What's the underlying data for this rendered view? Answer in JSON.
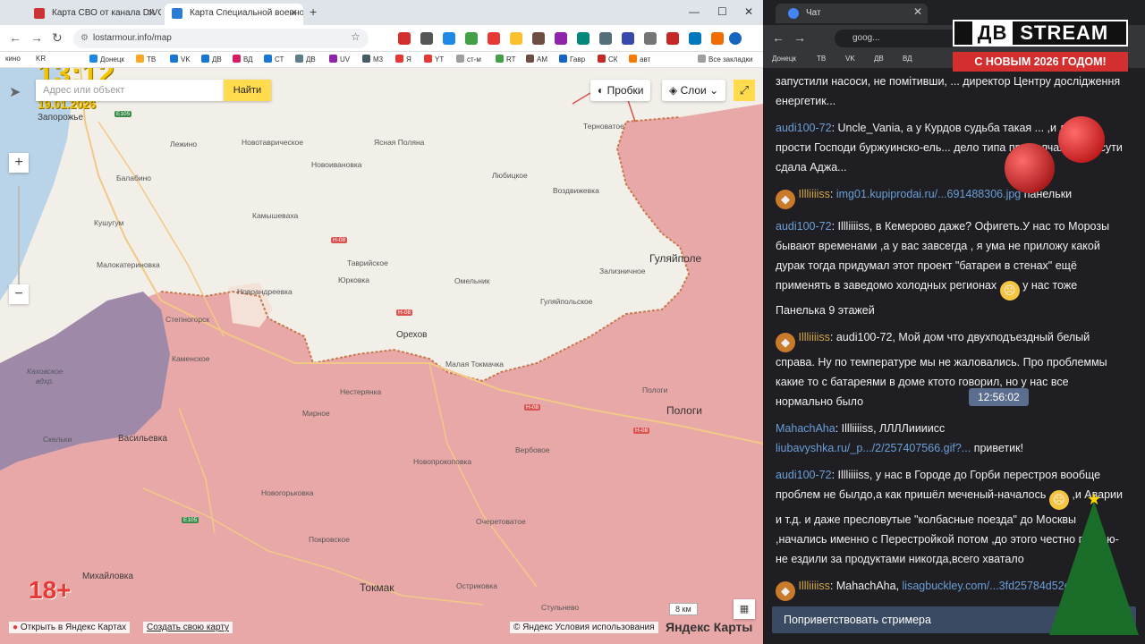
{
  "left_browser": {
    "tabs": [
      {
        "label": "Карта СВО от канала DIVGEN"
      },
      {
        "label": "Карта Специальной военной"
      }
    ],
    "new_tab": "+",
    "address": "lostarmour.info/map",
    "bookmarks": [
      "кино",
      "KR",
      "Донецк",
      "ТВ",
      "VK",
      "ДВ",
      "ВД",
      "СТ",
      "ДВ",
      "UV",
      "М3",
      "Я",
      "YT",
      "ст-м",
      "RT",
      "AM",
      "Гавр",
      "СК",
      "авт",
      "Все закладки"
    ]
  },
  "map": {
    "overlay_time": "13:12",
    "overlay_date": "19.01.2026",
    "search_placeholder": "Адрес или объект",
    "search_button": "Найти",
    "traffic_button": "Пробки",
    "layers_button": "Слои",
    "zoom_in": "+",
    "zoom_out": "−",
    "age_rating": "18+",
    "scale": "8 км",
    "open_in_yandex": "Открыть в Яндекс Картах",
    "create_map": "Создать свою карту",
    "copyright": "© Яндекс Условия использования",
    "yandex_logo": "Яндекс Карты",
    "places": {
      "zaporozhye": "Запорожье",
      "lezhino": "Лежино",
      "novotavricheskoe": "Новотаврическое",
      "yasnaya_polyana": "Ясная Поляна",
      "ternovatoe": "Терноватое",
      "novoivanovka": "Новоивановка",
      "lyubitskoe": "Любицкое",
      "balabino": "Балабино",
      "vozdvizhevka": "Воздвижевка",
      "kushugum": "Кушугум",
      "kamyshevakha": "Камышеваха",
      "malokaterinovka": "Малокатериновка",
      "tavricheskoe": "Таврийское",
      "yurkovka": "Юрковка",
      "omelnik": "Омельник",
      "zalizhnichnoe": "Зализничное",
      "gulyaipole": "Гуляйполе",
      "gulyaipolskoe": "Гуляйпольское",
      "novoandreevka": "Новоандреевка",
      "novoyakovlevka": "Новояковлевка",
      "stepnogorsk": "Степногорск",
      "orekhov": "Орехов",
      "kamenskoe": "Каменское",
      "malaya_tokmachka": "Малая Токмачка",
      "kakhovskoe": "Каховское",
      "vdkhr": "вдхр.",
      "nesteryanka": "Нестерянка",
      "pologi_small": "Пологи",
      "mirnoe": "Мирное",
      "pologi": "Пологи",
      "skelki": "Скельки",
      "vasilievka": "Васильевка",
      "verbovoe": "Вербовое",
      "novoprokopovka": "Новопрокоповка",
      "novogorodka": "Новогорьковка",
      "ocheretovatoe": "Очеретоватое",
      "pokrovskoe": "Покровское",
      "mikhailovka": "Михайловка",
      "tokmak": "Токмак",
      "ostrikovka": "Остриковка",
      "stulnevo": "Стульнево"
    },
    "roads": [
      "E105",
      "H-08",
      "H-08",
      "H-08",
      "H-08",
      "E105"
    ]
  },
  "right_browser": {
    "tab_label": "Чат",
    "address": "goog...",
    "bookmarks": [
      "Донецк",
      "ТВ",
      "VK",
      "ДВ",
      "ВД"
    ]
  },
  "chat": {
    "messages": [
      {
        "user": "",
        "text": "запустили насоси, не помітивши, ... директор Центру дослідження енергетик..."
      },
      {
        "user": "audi100-72",
        "text": "Uncle_Vania, а у Курдов судьба такая ... ,и даже прости Господи буржуинско-ель... дело типа промолчала и по сути сдала Аджа..."
      },
      {
        "user": "Illliiiiss",
        "link": "img01.kupiprodai.ru/...691488306.jpg",
        "text": "панельки"
      },
      {
        "user": "audi100-72",
        "text": "Illliiiiss, в Кемерово даже? Офигеть.У нас то Морозы бывают временами ,а у вас завсегда , я ума не приложу какой дурак тогда придумал этот проект \"батареи в стенах\" ещё применять в заведомо холодных регионах",
        "tail": "у нас тоже Панелька 9 этажей"
      },
      {
        "user": "Illliiiiss",
        "text": "audi100-72, Мой дом что двухподъездный белый справа. Ну по температуре мы не жаловались. Про проблеммы какие то с батареями в доме ктото говорил, но у нас все нормально было"
      },
      {
        "user": "MahachAha",
        "text": "Illliiiiss, ЛЛЛЛиииисс",
        "link": "liubavyshka.ru/_p.../2/257407566.gif?...",
        "tail": "приветик!"
      },
      {
        "user": "audi100-72",
        "text": "Illliiiiss, у нас в Городе до Горби перестроя вообще проблем не былдо,а как пришёл меченый-началось",
        "tail": ",и Аварии и т.д. и даже пресловутые \"колбасные поезда\" до Москвы ,начались именно с Перестройкой потом ,до этого честно говорю- не ездили за продуктами никогда,всего хватало"
      },
      {
        "user": "Illliiiiss",
        "text": "MahachAha,",
        "link": "lisagbuckley.com/...3fd25784d52e..."
      }
    ],
    "tooltip": "12:56:02",
    "greet_button": "Поприветствовать стримера"
  },
  "stream_overlay": {
    "logo_left": "ДВ",
    "logo_right": "STREAM",
    "banner": "С НОВЫМ 2026 ГОДОМ!"
  },
  "colors": {
    "occupied": "#e9a8a8",
    "frontline": "#c8784e",
    "water": "#9e8aa8",
    "accent_yellow": "#ffdb4d",
    "chat_user": "#6a9fd8"
  }
}
